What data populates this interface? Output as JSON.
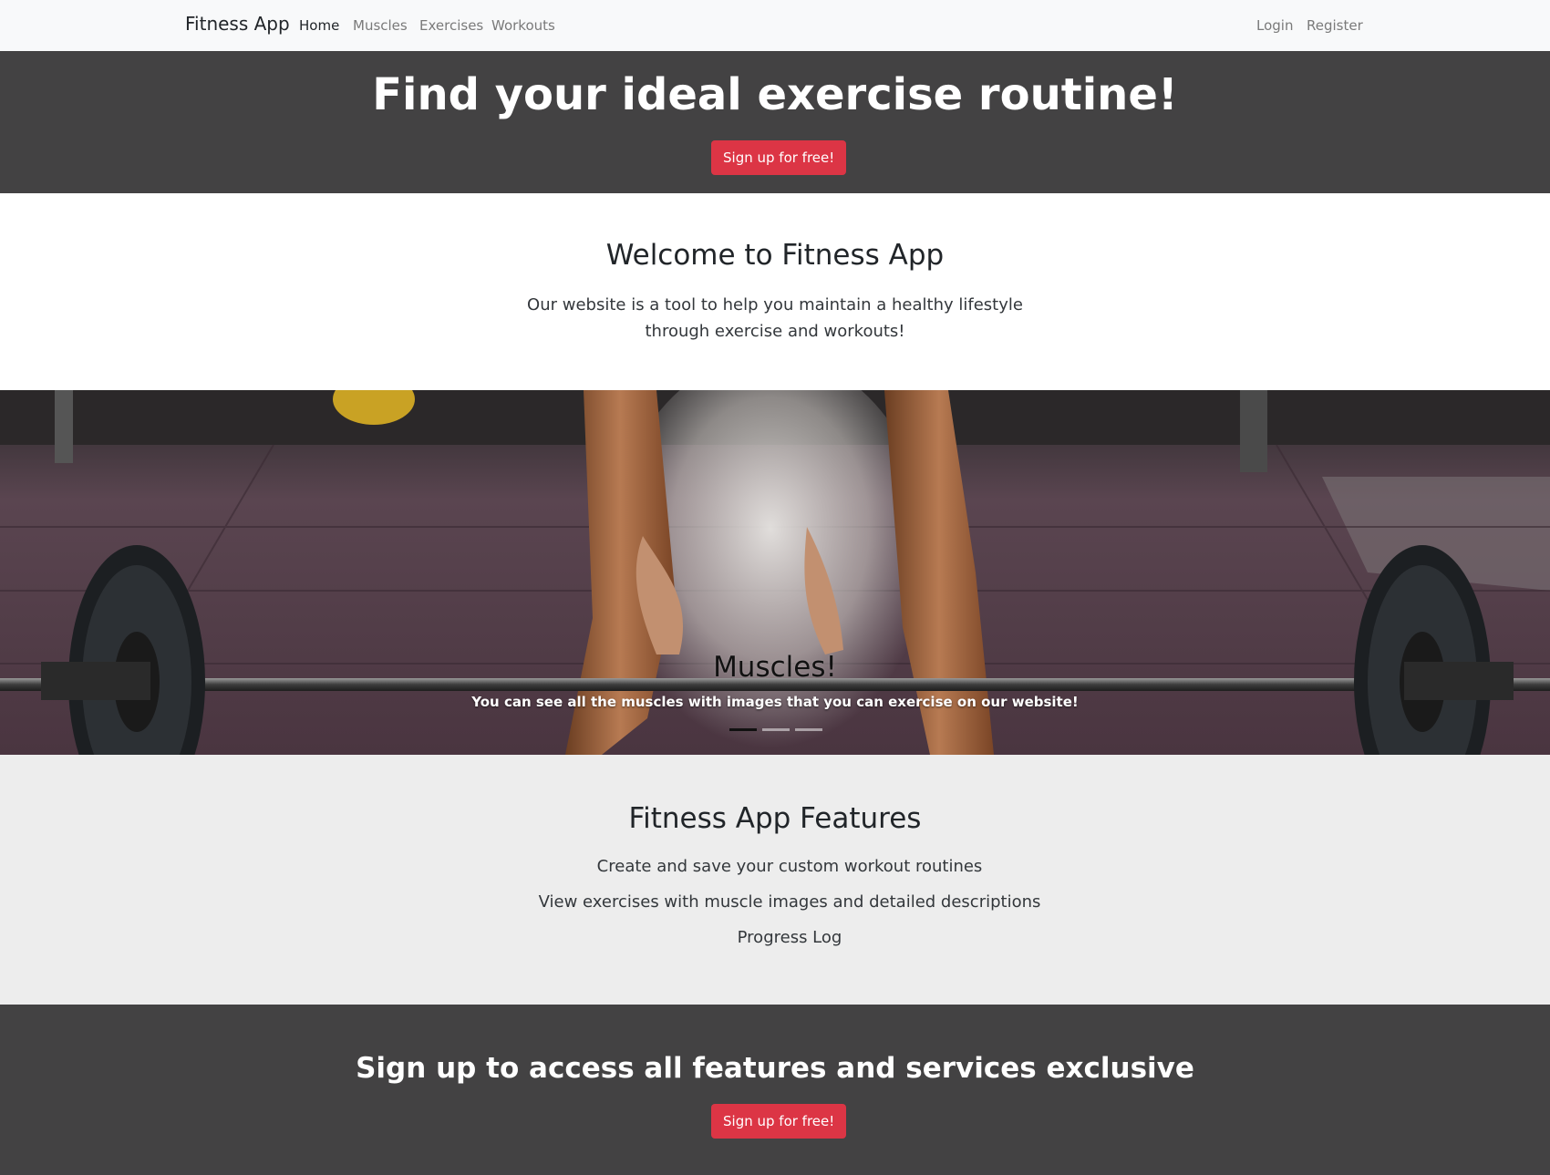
{
  "navbar": {
    "brand": "Fitness App",
    "links": [
      "Home",
      "Muscles",
      "Exercises",
      "Workouts"
    ],
    "active": "Home",
    "auth": [
      "Login",
      "Register"
    ]
  },
  "hero": {
    "title": "Find your ideal exercise routine!",
    "button": "Sign up for free!"
  },
  "welcome": {
    "title": "Welcome to Fitness App",
    "text": "Our website is a tool to help you maintain a healthy lifestyle through exercise and workouts!"
  },
  "carousel": {
    "caption_title": "Muscles!",
    "caption_text": "You can see all the muscles with images that you can exercise on our website!",
    "slides": 3,
    "active_slide": 1
  },
  "features": {
    "title": "Fitness App Features",
    "items": [
      "Create and save your custom workout routines",
      "View exercises with muscle images and detailed descriptions",
      "Progress Log"
    ]
  },
  "cta": {
    "title": "Sign up to access all features and services exclusive",
    "button": "Sign up for free!"
  },
  "colors": {
    "navbar_bg": "#f8f9fa",
    "dark_section": "#434243",
    "primary_button": "#dc3545",
    "features_bg": "#ededed"
  }
}
